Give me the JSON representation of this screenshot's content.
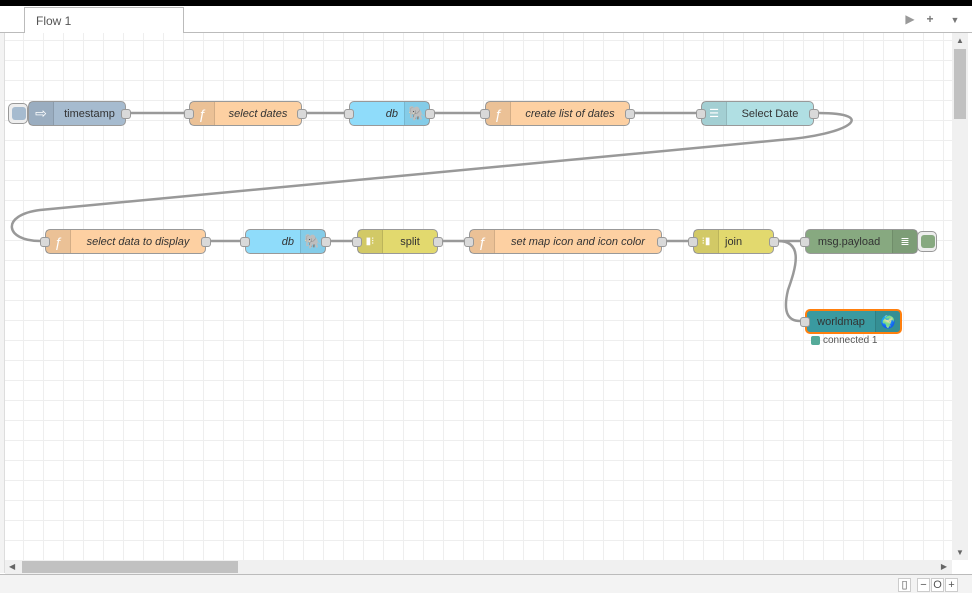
{
  "tabs": [
    {
      "label": "Flow 1"
    }
  ],
  "toolbar": {
    "deploy_icon": "caret-right-icon",
    "add_icon": "plus-icon",
    "menu_icon": "caret-down-icon"
  },
  "nodes": {
    "timestamp": {
      "label": "timestamp",
      "color": "#a6bbcf"
    },
    "select_dates": {
      "label": "select dates",
      "color": "#fdd0a2"
    },
    "db1": {
      "label": "db",
      "color": "#8fdcfa"
    },
    "create_list": {
      "label": "create list of dates",
      "color": "#fdd0a2"
    },
    "select_date": {
      "label": "Select Date",
      "color": "#b0dfe3"
    },
    "select_data": {
      "label": "select data to display",
      "color": "#fdd0a2"
    },
    "db2": {
      "label": "db",
      "color": "#8fdcfa"
    },
    "split": {
      "label": "split",
      "color": "#e2d96e"
    },
    "set_map": {
      "label": "set map icon and icon color",
      "color": "#fdd0a2"
    },
    "join": {
      "label": "join",
      "color": "#e2d96e"
    },
    "msg_payload": {
      "label": "msg.payload",
      "color": "#87a980"
    },
    "worldmap": {
      "label": "worldmap",
      "color": "#3a9aa0",
      "status": "connected 1"
    }
  },
  "footer": {
    "zoom_out": "−",
    "zoom_reset": "O",
    "zoom_in": "+"
  }
}
